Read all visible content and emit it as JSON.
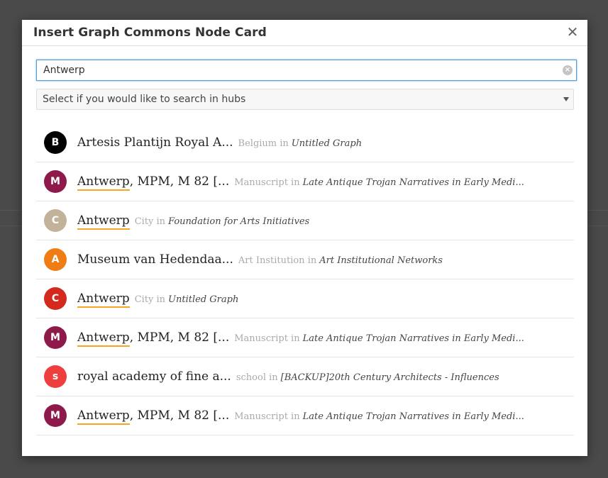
{
  "modal": {
    "title": "Insert Graph Commons Node Card",
    "close_glyph": "✕"
  },
  "search": {
    "value": "Antwerp",
    "placeholder": "",
    "clear_glyph": "×"
  },
  "hub_select": {
    "label": "Select if you would like to search in hubs"
  },
  "results": [
    {
      "initial": "B",
      "color": "#000000",
      "highlight": "",
      "rest": "Artesis Plantijn Royal A...",
      "type": "Belgium in",
      "graph": "Untitled Graph"
    },
    {
      "initial": "M",
      "color": "#8e1a4b",
      "highlight": "Antwerp",
      "rest": ", MPM, M 82 [...",
      "type": "Manuscript in",
      "graph": "Late Antique Trojan Narratives in Early Medi..."
    },
    {
      "initial": "C",
      "color": "#c2b299",
      "highlight": "Antwerp",
      "rest": "",
      "type": "City in",
      "graph": "Foundation for Arts Initiatives"
    },
    {
      "initial": "A",
      "color": "#f07c16",
      "highlight": "",
      "rest": "Museum van Hedendaa...",
      "type": "Art Institution in",
      "graph": "Art Institutional Networks"
    },
    {
      "initial": "C",
      "color": "#d42a1e",
      "highlight": "Antwerp",
      "rest": "",
      "type": "City in",
      "graph": "Untitled Graph"
    },
    {
      "initial": "M",
      "color": "#8e1a4b",
      "highlight": "Antwerp",
      "rest": ", MPM, M 82 [...",
      "type": "Manuscript in",
      "graph": "Late Antique Trojan Narratives in Early Medi..."
    },
    {
      "initial": "s",
      "color": "#ef3e3e",
      "highlight": "",
      "rest": "royal academy of fine a...",
      "type": "school in",
      "graph": "[BACKUP]20th Century Architects - Influences"
    },
    {
      "initial": "M",
      "color": "#8e1a4b",
      "highlight": "Antwerp",
      "rest": ", MPM, M 82 [...",
      "type": "Manuscript in",
      "graph": "Late Antique Trojan Narratives in Early Medi..."
    }
  ]
}
